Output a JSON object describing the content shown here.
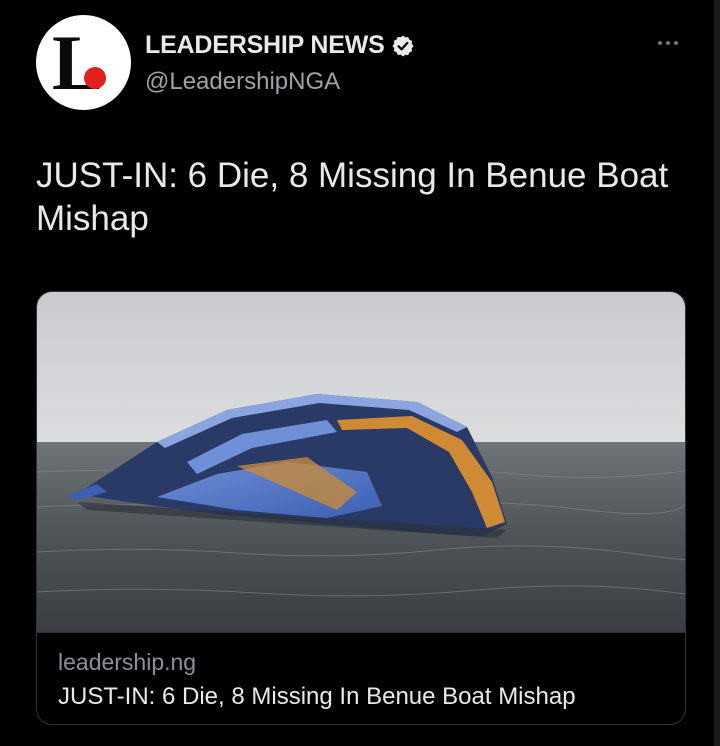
{
  "account": {
    "avatar_icon": "leadership-logo-icon",
    "display_name": "LEADERSHIP NEWS",
    "verified_icon": "verified-badge-icon",
    "handle": "@LeadershipNGA"
  },
  "menu": {
    "more_icon": "more-options-icon"
  },
  "tweet": {
    "text": "JUST-IN: 6 Die, 8 Missing In Benue Boat Mishap"
  },
  "card": {
    "image_icon": "capsized-boat-photo",
    "domain": "leadership.ng",
    "title": "JUST-IN: 6 Die, 8 Missing In Benue Boat Mishap"
  },
  "colors": {
    "background": "#000000",
    "primary_text": "#e7e9ea",
    "secondary_text": "#9ea3a8",
    "border": "#2f3336",
    "logo_red": "#e2211c"
  }
}
